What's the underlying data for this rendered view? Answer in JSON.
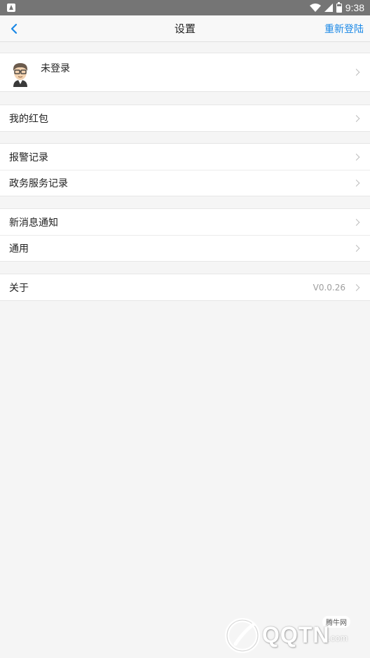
{
  "status_bar": {
    "time": "9:38"
  },
  "nav": {
    "title": "设置",
    "right_action": "重新登陆",
    "accent_color": "#1a88e6"
  },
  "profile": {
    "name": "未登录"
  },
  "groups": [
    {
      "items": [
        {
          "label": "我的红包"
        }
      ]
    },
    {
      "items": [
        {
          "label": "报警记录"
        },
        {
          "label": "政务服务记录"
        }
      ]
    },
    {
      "items": [
        {
          "label": "新消息通知"
        },
        {
          "label": "通用"
        }
      ]
    },
    {
      "items": [
        {
          "label": "关于",
          "value": "V0.0.26"
        }
      ]
    }
  ],
  "watermark": {
    "text": "QQTN",
    "suffix": ".com",
    "badge": "腾牛网"
  }
}
